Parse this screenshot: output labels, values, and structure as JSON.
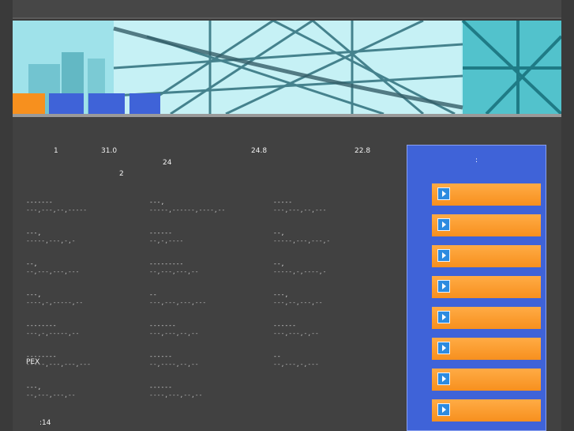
{
  "colors": {
    "page_bg": "#3a3a3a",
    "main_bg": "#414141",
    "sidebar_bg": "#3f63d8",
    "button_orange": "#f7901e",
    "tab_active": "#f7901e",
    "tab_blue": "#3f63d8"
  },
  "banner": {
    "tabs": [
      {
        "name": "tab-1",
        "color": "#f7901e"
      },
      {
        "name": "tab-2",
        "color": "#3f63d8"
      },
      {
        "name": "tab-3",
        "color": "#3f63d8"
      },
      {
        "name": "tab-4",
        "color": "#3f63d8"
      }
    ]
  },
  "prices": {
    "line1": [
      "1",
      "31.0",
      "24.8",
      "22.8"
    ],
    "line2": "24",
    "line3": "2"
  },
  "categories": [
    {
      "title": "-------",
      "desc": "---,---,--,-----"
    },
    {
      "title": "---,",
      "desc": "-----,------,----,--"
    },
    {
      "title": "-----",
      "desc": "---,---,--,---"
    },
    {
      "title": "---,",
      "desc": "-----,---,-,-"
    },
    {
      "title": "------",
      "desc": "--,-,----"
    },
    {
      "title": "--,",
      "desc": "-----,---,---,-"
    },
    {
      "title": "--,",
      "desc": "--,---,---,---"
    },
    {
      "title": "---------",
      "desc": "--,---,---,--"
    },
    {
      "title": "--,",
      "desc": "-----,-,----,-"
    },
    {
      "title": "---,",
      "desc": "----,-,-----,--"
    },
    {
      "title": "--",
      "desc": "---,---,---,---"
    },
    {
      "title": "---,",
      "desc": "---,--,---,--"
    },
    {
      "title": "--------",
      "desc": "---,-,-----,--"
    },
    {
      "title": "-------",
      "desc": "---,---,--,--"
    },
    {
      "title": "------",
      "desc": "---,---,-,--"
    },
    {
      "title": "--------",
      "desc": "-----,---,---,---"
    },
    {
      "title": "------",
      "desc": "--,----,--,--"
    },
    {
      "title": "--",
      "desc": "--,---,-,---"
    },
    {
      "title": "---,",
      "desc": "--,---,---,--"
    },
    {
      "title": "------",
      "desc": "----,---,--,--"
    }
  ],
  "pex_label": "PEX",
  "footer": ":14",
  "sidebar": {
    "title": ":",
    "buttons": [
      "",
      "",
      "",
      "",
      "",
      "",
      "",
      ""
    ]
  }
}
